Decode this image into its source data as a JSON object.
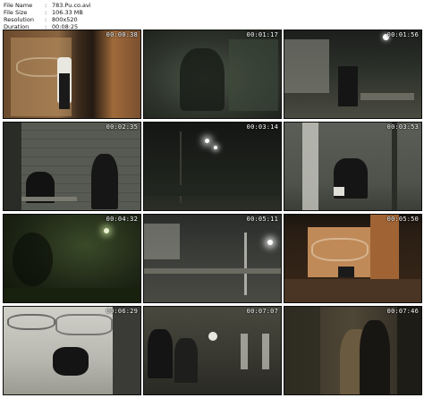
{
  "file_info": [
    {
      "key": "File Name",
      "sep": ":",
      "value": "783.Pu.co.avi"
    },
    {
      "key": "File Size",
      "sep": ":",
      "value": "106.33 MB"
    },
    {
      "key": "Resolution",
      "sep": ":",
      "value": "800x520"
    },
    {
      "key": "Duration",
      "sep": ":",
      "value": "00:08:25"
    }
  ],
  "thumbnails": [
    {
      "timestamp": "00:00:38"
    },
    {
      "timestamp": "00:01:17"
    },
    {
      "timestamp": "00:01:56"
    },
    {
      "timestamp": "00:02:35"
    },
    {
      "timestamp": "00:03:14"
    },
    {
      "timestamp": "00:03:53"
    },
    {
      "timestamp": "00:04:32"
    },
    {
      "timestamp": "00:05:11"
    },
    {
      "timestamp": "00:05:50"
    },
    {
      "timestamp": "00:06:29"
    },
    {
      "timestamp": "00:07:07"
    },
    {
      "timestamp": "00:07:46"
    }
  ]
}
